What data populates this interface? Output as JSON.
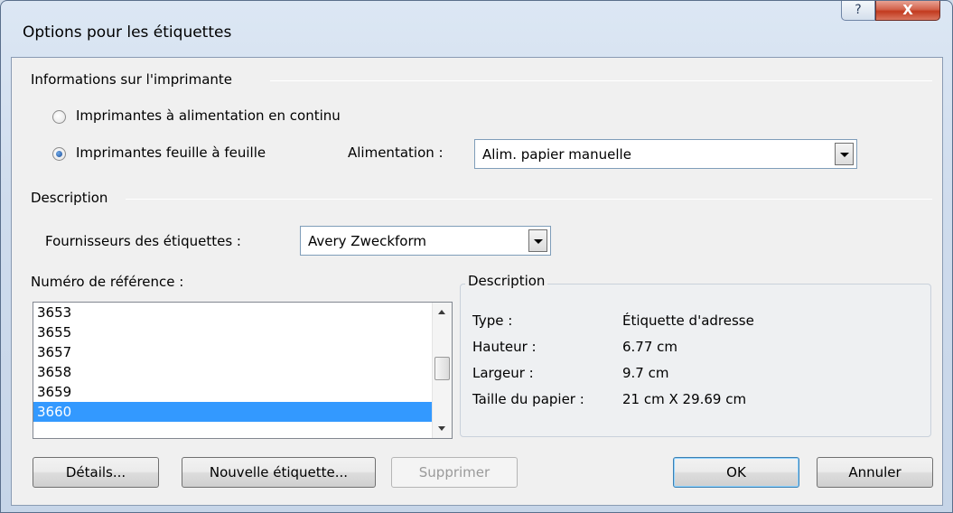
{
  "window": {
    "title": "Options pour les étiquettes",
    "help_glyph": "?",
    "close_glyph": "X"
  },
  "printer_info": {
    "heading": "Informations sur l'imprimante",
    "radio_continuous": "Imprimantes à alimentation en continu",
    "radio_sheet": "Imprimantes feuille à feuille",
    "selected": "sheet",
    "tray_label": "Alimentation :",
    "tray_value": "Alim. papier manuelle"
  },
  "description_section": {
    "heading": "Description",
    "vendor_label": "Fournisseurs des étiquettes :",
    "vendor_value": "Avery Zweckform"
  },
  "product_number": {
    "label": "Numéro de référence :",
    "items": [
      "3653",
      "3655",
      "3657",
      "3658",
      "3659",
      "3660"
    ],
    "selected": "3660"
  },
  "details": {
    "heading": "Description",
    "type_label": "Type :",
    "type_value": "Étiquette d'adresse",
    "height_label": "Hauteur :",
    "height_value": "6.77 cm",
    "width_label": "Largeur :",
    "width_value": "9.7 cm",
    "paper_label": "Taille du papier :",
    "paper_value": "21 cm X 29.69 cm"
  },
  "buttons": {
    "details": "Détails...",
    "new_label": "Nouvelle étiquette...",
    "delete": "Supprimer",
    "ok": "OK",
    "cancel": "Annuler"
  },
  "colors": {
    "selection": "#3399ff",
    "dialog_bg": "#f0f0f0",
    "close_button": "#c23a1f"
  }
}
